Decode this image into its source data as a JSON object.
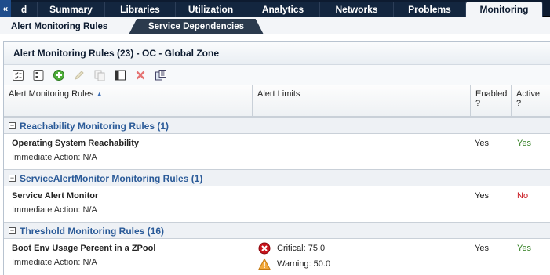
{
  "top_tabs": [
    {
      "label": "«d"
    },
    {
      "label": "Summary"
    },
    {
      "label": "Libraries"
    },
    {
      "label": "Utilization"
    },
    {
      "label": "Analytics"
    },
    {
      "label": "Networks"
    },
    {
      "label": "Problems"
    },
    {
      "label": "Monitoring"
    }
  ],
  "sub_tabs": {
    "active": "Alert Monitoring Rules",
    "other": "Service Dependencies"
  },
  "panel": {
    "title": "Alert Monitoring Rules (23) - OC - Global Zone"
  },
  "toolbar": {
    "icons": [
      "check-list-icon",
      "list-icon",
      "add-icon",
      "edit-icon",
      "copy-icon",
      "split-view-icon",
      "delete-icon",
      "export-icon"
    ]
  },
  "table": {
    "headers": {
      "rules": "Alert Monitoring Rules",
      "limits": "Alert Limits",
      "enabled": "Enabled ?",
      "active": "Active ?"
    },
    "groups": [
      {
        "title": "Reachability Monitoring Rules (1)",
        "rows": [
          {
            "name": "Operating System Reachability",
            "action": "Immediate Action: N/A",
            "enabled": "Yes",
            "active": "Yes"
          }
        ]
      },
      {
        "title": "ServiceAlertMonitor Monitoring Rules (1)",
        "rows": [
          {
            "name": "Service Alert Monitor",
            "action": "Immediate Action: N/A",
            "enabled": "Yes",
            "active": "No"
          }
        ]
      },
      {
        "title": "Threshold Monitoring Rules (16)",
        "rows": [
          {
            "name": "Boot Env Usage Percent in a ZPool",
            "action": "Immediate Action: N/A",
            "critical": "Critical: 75.0",
            "warning": "Warning: 50.0",
            "enabled": "Yes",
            "active": "Yes"
          }
        ]
      }
    ]
  },
  "colors": {
    "nav_bg": "#0d1b30",
    "group_title": "#2a5a98",
    "yes": "#2f7d1f",
    "no": "#c8141c"
  }
}
